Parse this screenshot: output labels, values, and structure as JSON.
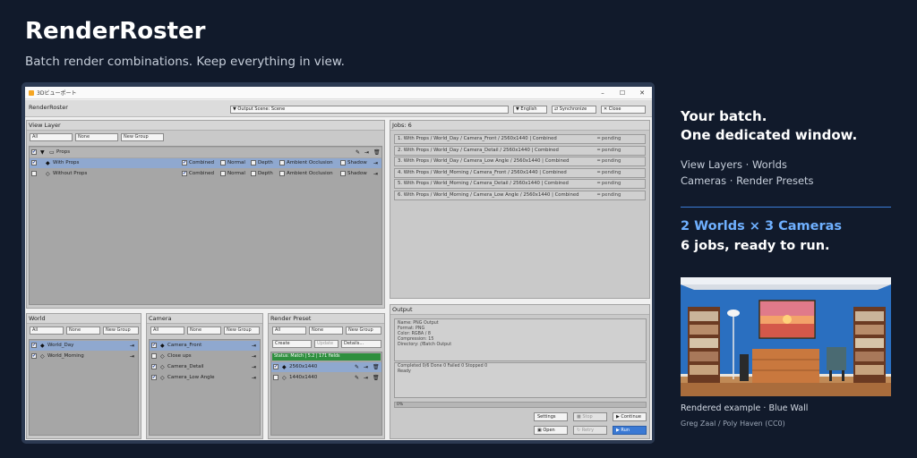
{
  "hero": {
    "title": "RenderRoster",
    "subtitle": "Batch render combinations. Keep everything in view."
  },
  "window": {
    "title": "3Dビューポート",
    "app_name": "RenderRoster",
    "toolbar": {
      "output_scene": "▼ Output Scene: Scene",
      "language": "▼ English",
      "synchronize": "⇄ Synchronize",
      "close": "✕ Close"
    },
    "controls": {
      "minimize": "–",
      "maximize": "☐",
      "close": "✕"
    }
  },
  "view_layer": {
    "header": "View Layer",
    "filters": {
      "all": "All",
      "none": "None",
      "new_group": "New Group"
    },
    "group": {
      "label": "Props",
      "checked": true
    },
    "rows": [
      {
        "label": "With Props",
        "checked": true,
        "selected": true,
        "combined": "Combined",
        "normal": "Normal",
        "depth": "Depth",
        "ao": "Ambient Occlusion",
        "shadow": "Shadow"
      },
      {
        "label": "Without Props",
        "checked": false,
        "selected": false,
        "combined": "Combined",
        "normal": "Normal",
        "depth": "Depth",
        "ao": "Ambient Occlusion",
        "shadow": "Shadow"
      }
    ]
  },
  "jobs": {
    "header": "Jobs: 6",
    "status": "pending",
    "items": [
      "1. With Props / World_Day / Camera_Front / 2560x1440 | Combined",
      "2. With Props / World_Day / Camera_Detail / 2560x1440 | Combined",
      "3. With Props / World_Day / Camera_Low Angle / 2560x1440 | Combined",
      "4. With Props / World_Morning / Camera_Front / 2560x1440 | Combined",
      "5. With Props / World_Morning / Camera_Detail / 2560x1440 | Combined",
      "6. With Props / World_Morning / Camera_Low Angle / 2560x1440 | Combined"
    ]
  },
  "world": {
    "header": "World",
    "filters": {
      "all": "All",
      "none": "None",
      "new_group": "New Group"
    },
    "items": [
      {
        "label": "World_Day",
        "checked": true,
        "selected": true
      },
      {
        "label": "World_Morning",
        "checked": true,
        "selected": false
      }
    ]
  },
  "camera": {
    "header": "Camera",
    "filters": {
      "all": "All",
      "none": "None",
      "new_group": "New Group"
    },
    "items": [
      {
        "label": "Camera_Front",
        "checked": true,
        "selected": true
      },
      {
        "label": "Close ups",
        "checked": false,
        "selected": false
      },
      {
        "label": "Camera_Detail",
        "checked": true,
        "selected": false
      },
      {
        "label": "Camera_Low Angle",
        "checked": true,
        "selected": false
      }
    ]
  },
  "render_preset": {
    "header": "Render Preset",
    "filters": {
      "all": "All",
      "none": "None",
      "new_group": "New Group"
    },
    "actions": {
      "create": "Create",
      "update": "Update",
      "details": "Details..."
    },
    "status": "Status: Match | 5.2 | 171 fields",
    "items": [
      {
        "label": "2560x1440",
        "checked": true,
        "selected": true
      },
      {
        "label": "1440x1440",
        "checked": false,
        "selected": false
      }
    ]
  },
  "output": {
    "header": "Output",
    "info": [
      "Name: PNG Output",
      "Format: PNG",
      "Color: RGBA / 8",
      "Compression: 15",
      "Directory: //Batch Output"
    ],
    "summary": [
      "Completed 0/6 Done 0 Failed 0 Stopped 0",
      "Ready"
    ],
    "progress_label": "0%",
    "progress": 0,
    "buttons": {
      "settings": "Settings",
      "stop": "■ Stop",
      "continue": "▶ Continue",
      "open": "Open",
      "retry": "↻ Retry",
      "run": "▶ Run"
    }
  },
  "sidebar": {
    "line1": "Your batch.",
    "line2": "One dedicated window.",
    "list1": "View Layers · Worlds",
    "list2": "Cameras · Render Presets",
    "combo": "2 Worlds × 3 Cameras",
    "ready": "6 jobs, ready to run.",
    "caption": "Rendered example · Blue Wall",
    "credit": "Greg Zaal / Poly Haven (CC0)"
  },
  "colors": {
    "background": "#111a2b",
    "accent": "#3b7dd8",
    "highlight_text": "#6fb0ff",
    "selection": "#8fa8cf",
    "status_green": "#2e8f3e"
  }
}
